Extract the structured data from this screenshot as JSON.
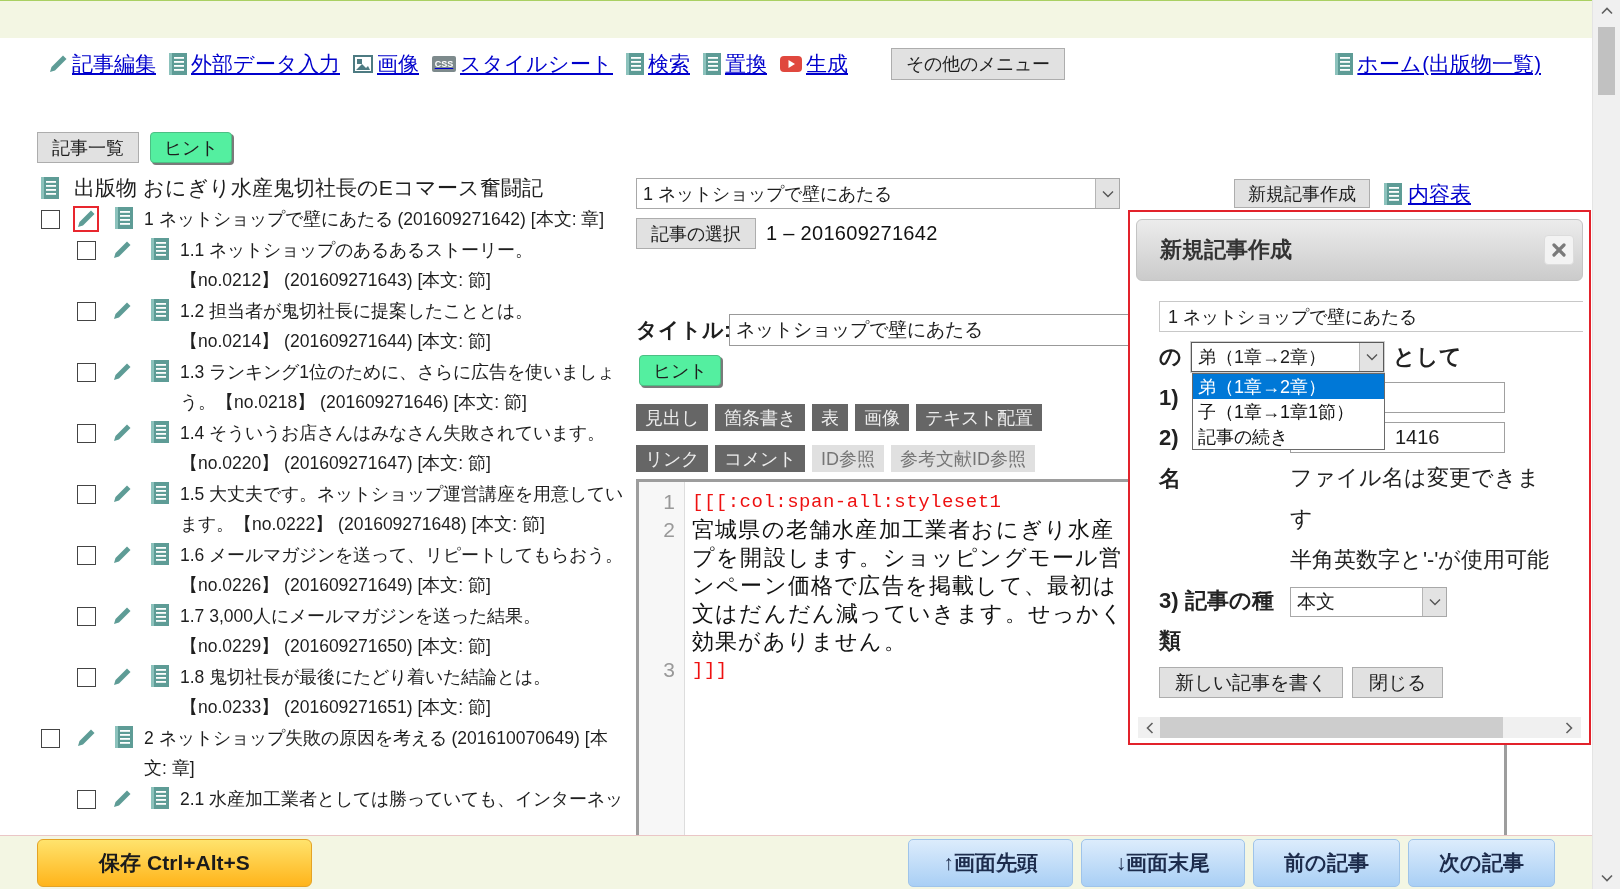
{
  "nav": {
    "links": [
      {
        "kind": "edit",
        "label": "記事編集"
      },
      {
        "kind": "doc",
        "label": "外部データ入力"
      },
      {
        "kind": "image",
        "label": "画像"
      },
      {
        "kind": "css",
        "icon_text": "CSS",
        "label": "スタイルシート"
      },
      {
        "kind": "doc",
        "label": "検索"
      },
      {
        "kind": "doc",
        "label": "置換"
      },
      {
        "kind": "play",
        "label": "生成"
      }
    ],
    "menu_button": "その他のメニュー",
    "home_link": "ホーム(出版物一覧)"
  },
  "subnav": [
    {
      "kind": "plain",
      "label": "記事一覧"
    },
    {
      "kind": "hint",
      "label": "ヒント"
    }
  ],
  "outline": {
    "title": "出版物 おにぎり水産鬼切社長のEコマース奮闘記",
    "items": [
      {
        "text": "1 ネットショップで壁にあたる (201609271642) [本文: 章]",
        "checked": false,
        "focused": true,
        "children": [
          {
            "text": "1.1 ネットショップのあるあるストーリー。【no.0212】 (201609271643) [本文: 節]",
            "checked": false,
            "focused": false
          },
          {
            "text": "1.2 担当者が鬼切社長に提案したこととは。【no.0214】 (201609271644) [本文: 節]",
            "checked": false,
            "focused": false
          },
          {
            "text": "1.3 ランキング1位のために、さらに広告を使いましょう。【no.0218】 (201609271646) [本文: 節]",
            "checked": false,
            "focused": false
          },
          {
            "text": "1.4 そういうお店さんはみなさん失敗されています。【no.0220】 (201609271647) [本文: 節]",
            "checked": false,
            "focused": false
          },
          {
            "text": "1.5 大丈夫です。ネットショップ運営講座を用意しています。【no.0222】 (201609271648) [本文: 節]",
            "checked": false,
            "focused": false
          },
          {
            "text": "1.6 メールマガジンを送って、リピートしてもらおう。【no.0226】 (201609271649) [本文: 節]",
            "checked": false,
            "focused": false
          },
          {
            "text": "1.7 3,000人にメールマガジンを送った結果。【no.0229】 (201609271650) [本文: 節]",
            "checked": false,
            "focused": false
          },
          {
            "text": "1.8 鬼切社長が最後にたどり着いた結論とは。【no.0233】 (201609271651) [本文: 節]",
            "checked": false,
            "focused": false
          }
        ]
      },
      {
        "text": "2 ネットショップ失敗の原因を考える (201610070649) [本文: 章]",
        "checked": false,
        "focused": false,
        "children": [
          {
            "text": "2.1 水産加工業者としては勝っていても、インターネッ",
            "checked": false,
            "focused": false
          }
        ]
      }
    ]
  },
  "article": {
    "select": "1 ネットショップで壁にあたる",
    "select_button": "記事の選択",
    "article_id": "1 – 201609271642",
    "new_button": "新規記事作成",
    "toc_link": "内容表",
    "title_label": "タイトル:",
    "title_value": "ネットショップで壁にあたる",
    "hint_button": "ヒント",
    "toolbar_rows": [
      [
        {
          "label": "見出し",
          "disabled": false
        },
        {
          "label": "箇条書き",
          "disabled": false
        },
        {
          "label": "表",
          "disabled": false
        },
        {
          "label": "画像",
          "disabled": false
        },
        {
          "label": "テキスト配置",
          "disabled": false
        }
      ],
      [
        {
          "label": "リンク",
          "disabled": false
        },
        {
          "label": "コメント",
          "disabled": false
        },
        {
          "label": "ID参照",
          "disabled": true
        },
        {
          "label": "参考文献ID参照",
          "disabled": true
        }
      ]
    ],
    "editor": {
      "lines": [
        {
          "number": "1",
          "kind": "markup",
          "segments": [
            "[[[:col:span-all:styleset1"
          ]
        },
        {
          "number": "2",
          "kind": "text",
          "segments": [
            "宮城県の老舗水産加工業者おにぎり水産",
            "プを開設します。ショッピングモール営",
            "ンペーン価格で広告を掲載して、最初は",
            "文はだんだん減っていきます。せっかく",
            "効果がありません。"
          ]
        },
        {
          "number": "3",
          "kind": "markup",
          "segments": [
            "]]]"
          ]
        }
      ]
    }
  },
  "dialog": {
    "title": "新規記事作成",
    "parent": "1 ネットショップで壁にあたる",
    "relation": {
      "prefix": "の",
      "value": "弟（1章→2章）",
      "suffix": "として",
      "open": true,
      "options": [
        {
          "label": "弟（1章→2章）",
          "selected": true
        },
        {
          "label": "子（1章→1章1節）",
          "selected": false
        },
        {
          "label": "記事の続き",
          "selected": false
        }
      ]
    },
    "fields": [
      {
        "label": "1)"
      },
      {
        "label": "2)",
        "value": "1416"
      }
    ],
    "filename_label": "名",
    "notes": [
      "ファイル名は変更できます",
      "半角英数字と'-'が使用可能"
    ],
    "type": {
      "label": "3) 記事の種類",
      "value": "本文"
    },
    "buttons": [
      "新しい記事を書く",
      "閉じる"
    ]
  },
  "bottom_bar": {
    "save_button": "保存 Ctrl+Alt+S",
    "nav_buttons": [
      "↑画面先頭",
      "↓画面末尾",
      "前の記事",
      "次の記事"
    ]
  }
}
